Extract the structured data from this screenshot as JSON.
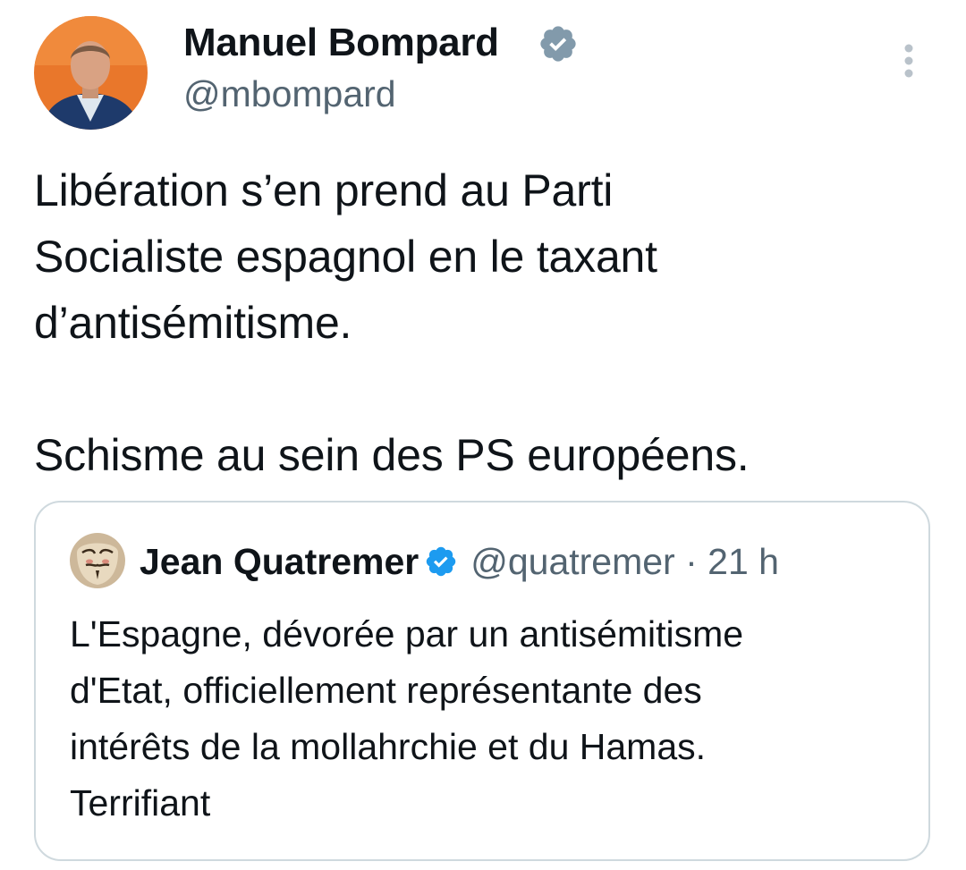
{
  "author": {
    "display_name": "Manuel Bompard",
    "handle": "@mbompard",
    "verified_badge_color": "#829aab",
    "avatar_icon": "profile-photo"
  },
  "more_icon": "vertical-dots-icon",
  "tweet": {
    "paragraph_1": [
      "Libération s’en prend au Parti",
      "Socialiste espagnol en le taxant",
      "d’antisémitisme."
    ],
    "paragraph_2": "Schisme au sein des PS européens."
  },
  "quote": {
    "display_name": "Jean Quatremer",
    "handle": "@quatremer",
    "separator": "·",
    "time": "21 h",
    "verified_badge_color": "#1d9bf0",
    "text_lines": [
      "L'Espagne, dévorée par un antisémitisme",
      "d'Etat, officiellement représentante des",
      "intérêts de la mollahrchie et du Hamas.",
      "Terrifiant"
    ]
  },
  "colors": {
    "text": "#0f1419",
    "secondary_text": "#536471",
    "border": "#cfd9de"
  }
}
